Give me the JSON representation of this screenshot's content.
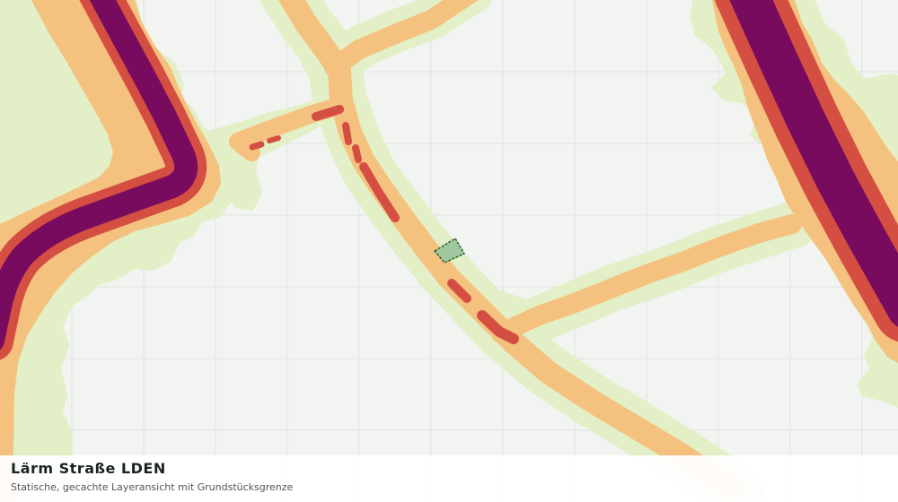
{
  "footer": {
    "title": "Lärm Straße LDEN",
    "subtitle": "Statische, gecachte Layeransicht mit Grundstücksgrenze"
  },
  "colors": {
    "background": "#f2f4f1",
    "grid": "#dfe2de",
    "band_low": "#e3efc6",
    "band_mid": "#f4c27e",
    "band_high": "#d44f42",
    "band_very_high": "#790b5e",
    "parcel_fill": "#a0c79d",
    "parcel_stroke": "#26572c"
  },
  "icons": {
    "parcel": "parcel-boundary-polygon"
  }
}
